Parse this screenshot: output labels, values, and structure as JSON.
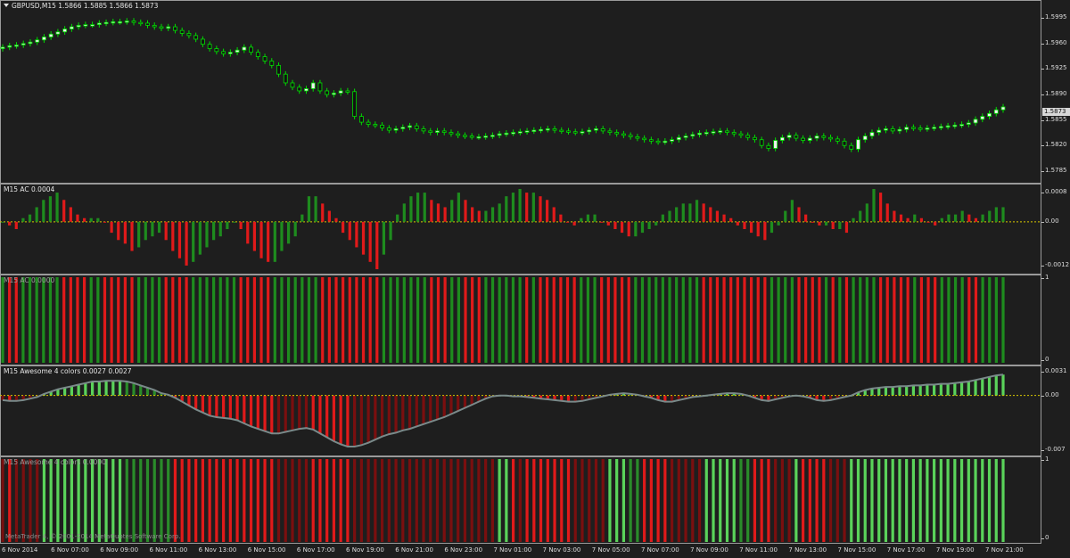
{
  "chart_data": [
    {
      "type": "candlestick",
      "title": "GBPUSD,M15  1.5866 1.5885 1.5866 1.5873",
      "symbol": "GBPUSD,M15",
      "ohlc_header": [
        "1.5866",
        "1.5885",
        "1.5866",
        "1.5873"
      ],
      "y_ticks": [
        "1.5995",
        "1.5960",
        "1.5925",
        "1.5890",
        "1.5855",
        "1.5820",
        "1.5785"
      ],
      "ylim": [
        1.5775,
        1.601
      ],
      "current_price": "1.5873",
      "colors": {
        "bull": "#f0f0f0",
        "bear": "#111111",
        "wick": "#00dd00"
      },
      "close": [
        1.5955,
        1.5957,
        1.5958,
        1.596,
        1.5962,
        1.5965,
        1.5969,
        1.5973,
        1.5976,
        1.598,
        1.5983,
        1.5985,
        1.5986,
        1.5986,
        1.5988,
        1.5989,
        1.599,
        1.599,
        1.5991,
        1.5989,
        1.5988,
        1.5985,
        1.5983,
        1.5981,
        1.5983,
        1.5978,
        1.5974,
        1.5971,
        1.5966,
        1.5959,
        1.5953,
        1.5949,
        1.5946,
        1.5948,
        1.5951,
        1.5955,
        1.5948,
        1.5942,
        1.5936,
        1.593,
        1.5918,
        1.5906,
        1.59,
        1.5895,
        1.5898,
        1.5906,
        1.5895,
        1.589,
        1.5892,
        1.5895,
        1.5894,
        1.586,
        1.5852,
        1.5849,
        1.5848,
        1.5844,
        1.5841,
        1.5843,
        1.5845,
        1.5847,
        1.5843,
        1.584,
        1.5838,
        1.584,
        1.5838,
        1.5836,
        1.5834,
        1.5833,
        1.5832,
        1.5832,
        1.5833,
        1.5834,
        1.5836,
        1.5837,
        1.5838,
        1.5839,
        1.584,
        1.5841,
        1.5842,
        1.5843,
        1.5841,
        1.584,
        1.5839,
        1.5838,
        1.5839,
        1.5841,
        1.5843,
        1.584,
        1.5838,
        1.5836,
        1.5834,
        1.5832,
        1.583,
        1.5828,
        1.5826,
        1.5825,
        1.5826,
        1.5828,
        1.5831,
        1.5833,
        1.5835,
        1.5837,
        1.5838,
        1.5839,
        1.584,
        1.5838,
        1.5836,
        1.5834,
        1.5831,
        1.5828,
        1.582,
        1.5816,
        1.5827,
        1.5831,
        1.5834,
        1.583,
        1.5827,
        1.583,
        1.5833,
        1.5831,
        1.5829,
        1.5826,
        1.582,
        1.5815,
        1.5828,
        1.5833,
        1.5838,
        1.5841,
        1.5843,
        1.584,
        1.5842,
        1.5845,
        1.5844,
        1.5843,
        1.5844,
        1.5845,
        1.5846,
        1.5847,
        1.5848,
        1.5849,
        1.5851,
        1.5856,
        1.586,
        1.5864,
        1.5869,
        1.5873
      ],
      "ac_values_note": "ac histogram values (M15 AC 0.0004)",
      "ac_title": "M15 AC 0.0004",
      "ac_y_ticks": [
        "0.0008",
        "0.00",
        "-0.0012"
      ],
      "ac_ylim": [
        -0.0013,
        0.0009
      ],
      "ac_values": [
        0.0,
        -0.0001,
        -0.0002,
        0.0001,
        0.0002,
        0.0004,
        0.0006,
        0.0007,
        0.0008,
        0.0006,
        0.0004,
        0.0002,
        0.0001,
        0.0001,
        0.0001,
        0.0,
        -0.0003,
        -0.0005,
        -0.0006,
        -0.0008,
        -0.0007,
        -0.0005,
        -0.0004,
        -0.0003,
        -0.0005,
        -0.0008,
        -0.001,
        -0.0012,
        -0.0011,
        -0.0009,
        -0.0007,
        -0.0005,
        -0.0004,
        -0.0002,
        0.0,
        -0.0002,
        -0.0006,
        -0.0008,
        -0.001,
        -0.0011,
        -0.0011,
        -0.0008,
        -0.0006,
        -0.0004,
        0.0002,
        0.0007,
        0.0007,
        0.0005,
        0.0003,
        0.0001,
        -0.0003,
        -0.0005,
        -0.0007,
        -0.0009,
        -0.0011,
        -0.0013,
        -0.0009,
        -0.0005,
        0.0002,
        0.0005,
        0.0007,
        0.0008,
        0.0008,
        0.0006,
        0.0005,
        0.0004,
        0.0006,
        0.0008,
        0.0006,
        0.0004,
        0.0003,
        0.0003,
        0.0004,
        0.0005,
        0.0007,
        0.0008,
        0.0009,
        0.0008,
        0.0008,
        0.0007,
        0.0006,
        0.0004,
        0.0002,
        0.0,
        -0.0001,
        0.0001,
        0.0002,
        0.0002,
        0.0,
        -0.0001,
        -0.0002,
        -0.0003,
        -0.0004,
        -0.0004,
        -0.0003,
        -0.0002,
        -0.0001,
        0.0002,
        0.0003,
        0.0004,
        0.0005,
        0.0005,
        0.0006,
        0.0005,
        0.0004,
        0.0003,
        0.0002,
        0.0001,
        -0.0001,
        -0.0002,
        -0.0003,
        -0.0004,
        -0.0005,
        -0.0003,
        -0.0001,
        0.0003,
        0.0006,
        0.0004,
        0.0002,
        0.0,
        -0.0001,
        -0.0001,
        -0.0002,
        -0.0002,
        -0.0003,
        0.0001,
        0.0003,
        0.0005,
        0.0009,
        0.0008,
        0.0005,
        0.0003,
        0.0002,
        0.0001,
        0.0002,
        0.0001,
        0.0,
        -0.0001,
        0.0001,
        0.0002,
        0.0002,
        0.0003,
        0.0002,
        0.0001,
        0.0002,
        0.0003,
        0.0004,
        0.0004
      ],
      "ac_colors_hex": {
        "up": "#1e8c1e",
        "down": "#e01a1a"
      },
      "ac2_title": "M15 AC 0.0000",
      "ac2_y_ticks": [
        "1",
        "0"
      ],
      "awesome_title": "M15 Awesome 4 colors 0.0027 0.0027",
      "awesome_y_ticks": [
        "0.0031",
        "0.00",
        "-0.007"
      ],
      "awesome_ylim": [
        -0.0074,
        0.0033
      ],
      "awesome_values": [
        -0.0006,
        -0.0007,
        -0.0007,
        -0.0006,
        -0.0004,
        -0.0002,
        0.0002,
        0.0005,
        0.0008,
        0.001,
        0.0012,
        0.0014,
        0.0016,
        0.0018,
        0.0018,
        0.0019,
        0.0019,
        0.0019,
        0.0018,
        0.0016,
        0.0013,
        0.001,
        0.0007,
        0.0003,
        0.0001,
        -0.0003,
        -0.0008,
        -0.0013,
        -0.0018,
        -0.0022,
        -0.0026,
        -0.0028,
        -0.0029,
        -0.003,
        -0.0032,
        -0.0036,
        -0.004,
        -0.0043,
        -0.0046,
        -0.0049,
        -0.0049,
        -0.0047,
        -0.0045,
        -0.0043,
        -0.0042,
        -0.0044,
        -0.0049,
        -0.0054,
        -0.0059,
        -0.0063,
        -0.0066,
        -0.0066,
        -0.0064,
        -0.0061,
        -0.0057,
        -0.0053,
        -0.005,
        -0.0048,
        -0.0045,
        -0.0043,
        -0.004,
        -0.0037,
        -0.0034,
        -0.0031,
        -0.0028,
        -0.0024,
        -0.002,
        -0.0016,
        -0.0012,
        -0.0008,
        -0.0004,
        -0.0001,
        0.0,
        0.0,
        -0.0001,
        -0.0001,
        -0.0002,
        -0.0003,
        -0.0004,
        -0.0005,
        -0.0006,
        -0.0007,
        -0.0008,
        -0.0008,
        -0.0007,
        -0.0005,
        -0.0003,
        -0.0001,
        0.0001,
        0.0002,
        0.0003,
        0.0002,
        0.0001,
        -0.0001,
        -0.0003,
        -0.0006,
        -0.0008,
        -0.0008,
        -0.0006,
        -0.0004,
        -0.0002,
        -0.0001,
        0.0,
        0.0001,
        0.0002,
        0.0003,
        0.0003,
        0.0002,
        0.0,
        -0.0003,
        -0.0006,
        -0.0007,
        -0.0005,
        -0.0003,
        -0.0001,
        0.0,
        -0.0001,
        -0.0003,
        -0.0006,
        -0.0007,
        -0.0006,
        -0.0004,
        -0.0002,
        0.0,
        0.0004,
        0.0007,
        0.0009,
        0.001,
        0.0011,
        0.0011,
        0.0012,
        0.0012,
        0.0013,
        0.0013,
        0.0014,
        0.0014,
        0.0015,
        0.0015,
        0.0016,
        0.0017,
        0.0018,
        0.002,
        0.0022,
        0.0024,
        0.0026,
        0.0027
      ],
      "awesome_colors_hex": {
        "up_pos": "#5ad35a",
        "down_pos": "#2a8c2a",
        "down_neg": "#e01a1a",
        "up_neg": "#7a0f0f",
        "line": "#7a8a8a"
      },
      "awesome2_title": "M15 Awesome 4 colors 0.0000",
      "awesome2_y_ticks": [
        "1",
        "0"
      ],
      "x_labels": [
        "6 Nov 2014",
        "6 Nov 07:00",
        "6 Nov 09:00",
        "6 Nov 11:00",
        "6 Nov 13:00",
        "6 Nov 15:00",
        "6 Nov 17:00",
        "6 Nov 19:00",
        "6 Nov 21:00",
        "6 Nov 23:00",
        "7 Nov 01:00",
        "7 Nov 03:00",
        "7 Nov 05:00",
        "7 Nov 07:00",
        "7 Nov 09:00",
        "7 Nov 11:00",
        "7 Nov 13:00",
        "7 Nov 15:00",
        "7 Nov 17:00",
        "7 Nov 19:00",
        "7 Nov 21:00"
      ],
      "copyright": "MetaTrader 4, © 2001-2014 MetaQuotes Software Corp."
    }
  ]
}
